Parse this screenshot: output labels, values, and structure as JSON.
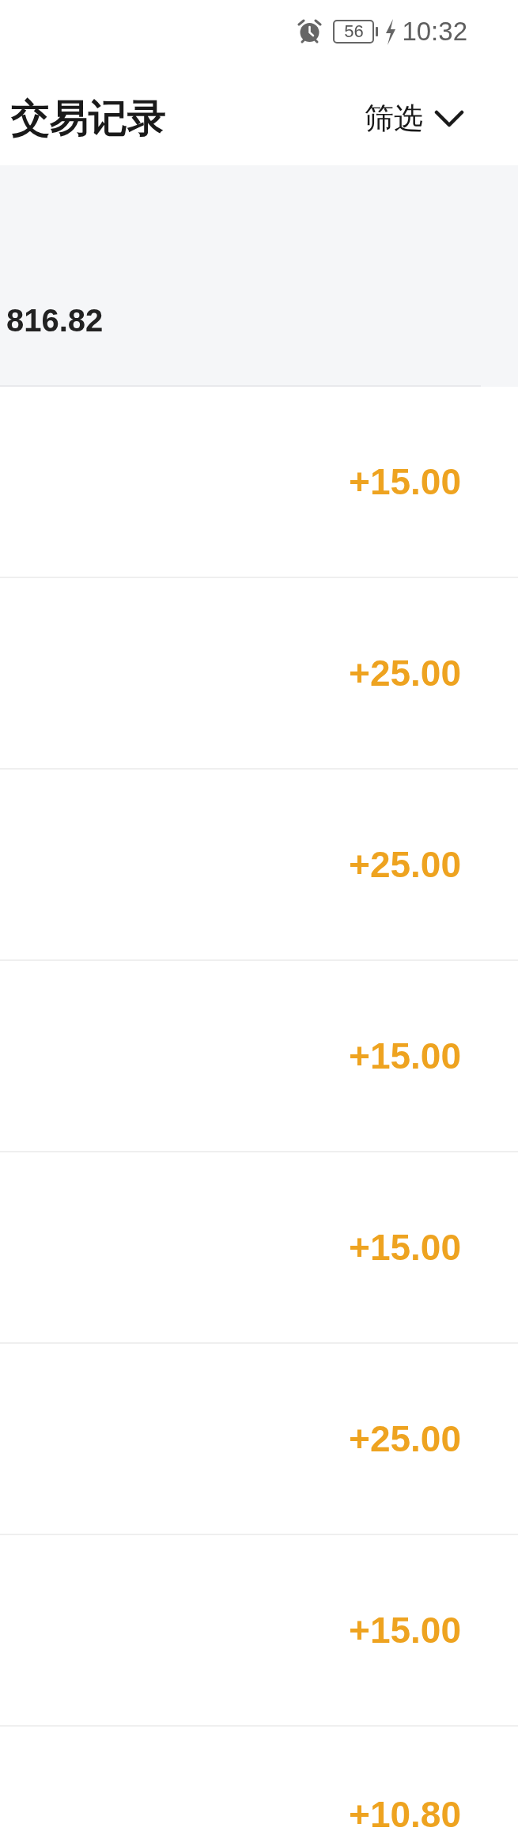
{
  "status_bar": {
    "battery_text": "56",
    "time": "10:32"
  },
  "header": {
    "title": "交易记录",
    "filter_label": "筛选"
  },
  "summary": {
    "amount": "816.82"
  },
  "transactions": [
    {
      "amount": "+15.00"
    },
    {
      "amount": "+25.00"
    },
    {
      "amount": "+25.00"
    },
    {
      "amount": "+15.00"
    },
    {
      "amount": "+15.00"
    },
    {
      "amount": "+25.00"
    },
    {
      "amount": "+15.00"
    },
    {
      "amount": "+10.80"
    }
  ]
}
